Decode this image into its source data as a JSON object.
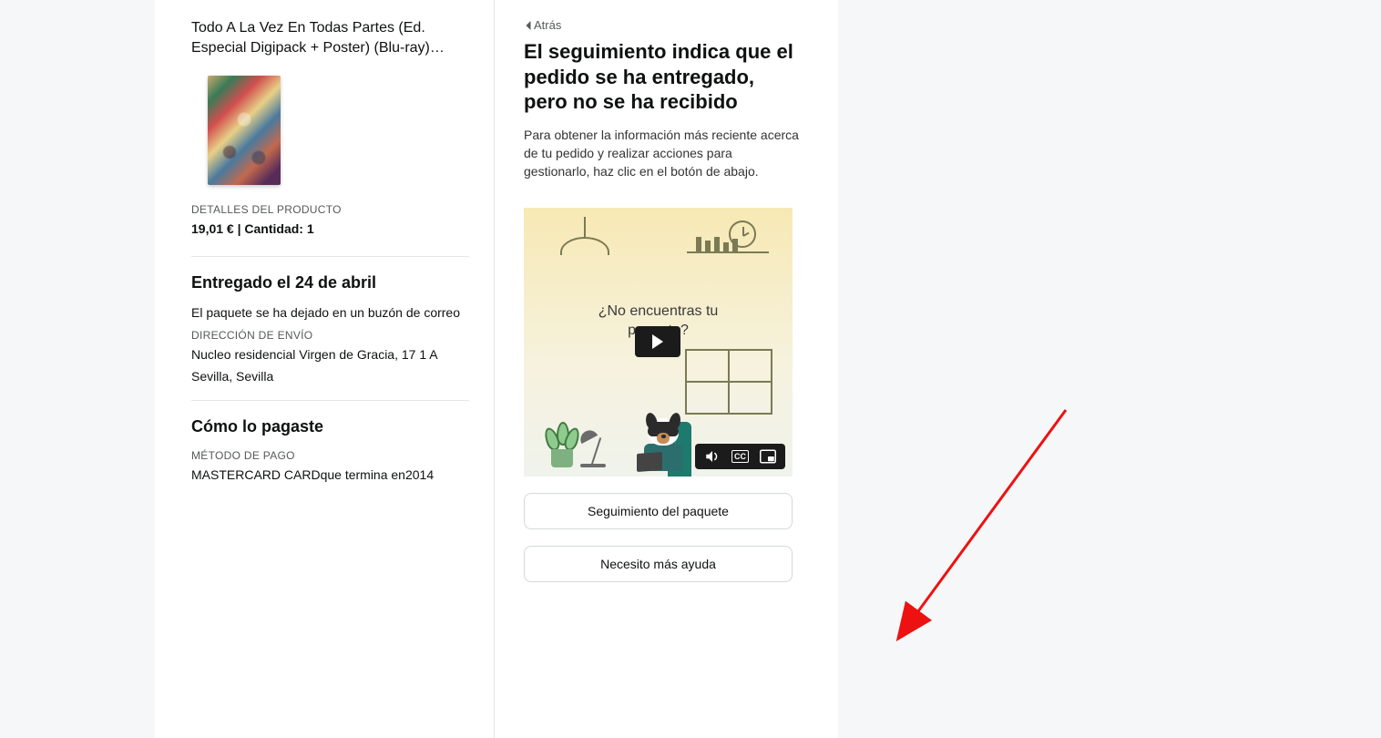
{
  "product": {
    "title": "Todo A La Vez En Todas Partes (Ed. Especial Digipack + Poster) (Blu-ray)…",
    "details_label": "DETALLES DEL PRODUCTO",
    "price_qty": "19,01 € | Cantidad: 1"
  },
  "delivery": {
    "heading": "Entregado el 24 de abril",
    "status": "El paquete se ha dejado en un buzón de correo",
    "address_label": "DIRECCIÓN DE ENVÍO",
    "address_line1": "Nucleo residencial Virgen de Gracia, 17 1 A",
    "address_line2": "Sevilla, Sevilla"
  },
  "payment": {
    "heading": "Cómo lo pagaste",
    "method_label": "MÉTODO DE PAGO",
    "method_value": "MASTERCARD CARDque termina en2014"
  },
  "help": {
    "back": "Atrás",
    "title": "El seguimiento indica que el pedido se ha entregado, pero no se ha recibido",
    "body": "Para obtener la información más reciente acerca de tu pedido y realizar acciones para gestionarlo, haz clic en el botón de abajo.",
    "video_question_l1": "¿No encuentras tu",
    "video_question_l2": "paquete?",
    "btn_track": "Seguimiento del paquete",
    "btn_more": "Necesito más ayuda"
  }
}
